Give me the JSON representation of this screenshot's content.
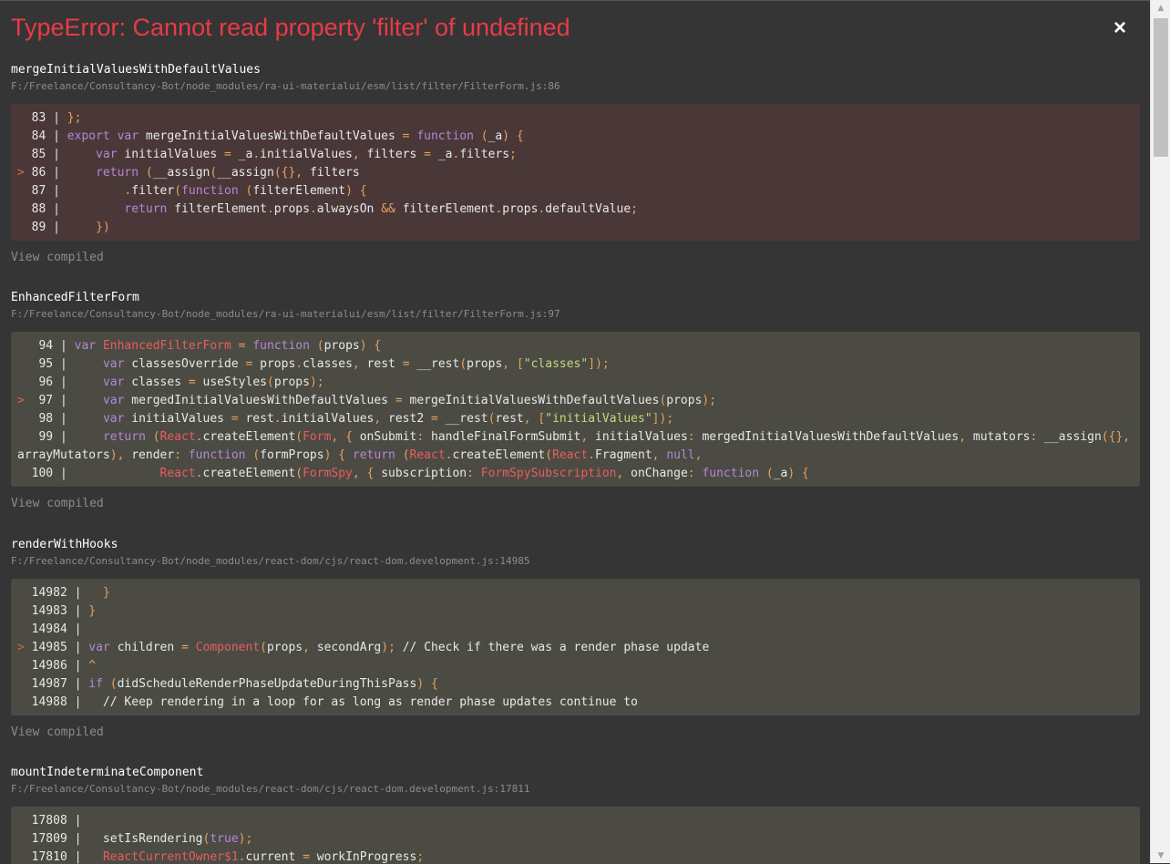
{
  "error": {
    "title": "TypeError: Cannot read property 'filter' of undefined",
    "close_label": "×"
  },
  "view_compiled_label": "View compiled",
  "frames": [
    {
      "function": "mergeInitialValuesWithDefaultValues",
      "file": "F:/Freelance/Consultancy-Bot/node_modules/ra-ui-materialui/esm/list/filter/FilterForm.js:86",
      "highlighted": true,
      "lines": [
        {
          "num": "83",
          "text": "};"
        },
        {
          "num": "84",
          "text": "export var mergeInitialValuesWithDefaultValues = function (_a) {"
        },
        {
          "num": "85",
          "text": "    var initialValues = _a.initialValues, filters = _a.filters;"
        },
        {
          "num": "86",
          "text": "    return (__assign(__assign({}, filters",
          "marked": true
        },
        {
          "num": "87",
          "text": "        .filter(function (filterElement) {"
        },
        {
          "num": "88",
          "text": "        return filterElement.props.alwaysOn && filterElement.props.defaultValue;"
        },
        {
          "num": "89",
          "text": "    })"
        }
      ]
    },
    {
      "function": "EnhancedFilterForm",
      "file": "F:/Freelance/Consultancy-Bot/node_modules/ra-ui-materialui/esm/list/filter/FilterForm.js:97",
      "highlighted": false,
      "lines": [
        {
          "num": "94",
          "text": "var EnhancedFilterForm = function (props) {"
        },
        {
          "num": "95",
          "text": "    var classesOverride = props.classes, rest = __rest(props, [\"classes\"]);"
        },
        {
          "num": "96",
          "text": "    var classes = useStyles(props);"
        },
        {
          "num": "97",
          "text": "    var mergedInitialValuesWithDefaultValues = mergeInitialValuesWithDefaultValues(props);",
          "marked": true
        },
        {
          "num": "98",
          "text": "    var initialValues = rest.initialValues, rest2 = __rest(rest, [\"initialValues\"]);"
        },
        {
          "num": "99",
          "text": "    return (React.createElement(Form, { onSubmit: handleFinalFormSubmit, initialValues: mergedInitialValuesWithDefaultValues, mutators: __assign({},"
        },
        {
          "num": "",
          "text": "arrayMutators), render: function (formProps) { return (React.createElement(React.Fragment, null,",
          "wrap": true
        },
        {
          "num": "100",
          "text": "            React.createElement(FormSpy, { subscription: FormSpySubscription, onChange: function (_a) {"
        }
      ]
    },
    {
      "function": "renderWithHooks",
      "file": "F:/Freelance/Consultancy-Bot/node_modules/react-dom/cjs/react-dom.development.js:14985",
      "highlighted": false,
      "lines": [
        {
          "num": "14982",
          "text": "  }"
        },
        {
          "num": "14983",
          "text": "}"
        },
        {
          "num": "14984",
          "text": ""
        },
        {
          "num": "14985",
          "text": "var children = Component(props, secondArg); // Check if there was a render phase update",
          "marked": true
        },
        {
          "num": "14986",
          "text": "^"
        },
        {
          "num": "14987",
          "text": "if (didScheduleRenderPhaseUpdateDuringThisPass) {"
        },
        {
          "num": "14988",
          "text": "  // Keep rendering in a loop for as long as render phase updates continue to"
        }
      ]
    },
    {
      "function": "mountIndeterminateComponent",
      "file": "F:/Freelance/Consultancy-Bot/node_modules/react-dom/cjs/react-dom.development.js:17811",
      "highlighted": false,
      "lines": [
        {
          "num": "17808",
          "text": ""
        },
        {
          "num": "17809",
          "text": "  setIsRendering(true);"
        },
        {
          "num": "17810",
          "text": "  ReactCurrentOwner$1.current = workInProgress;"
        }
      ]
    }
  ]
}
